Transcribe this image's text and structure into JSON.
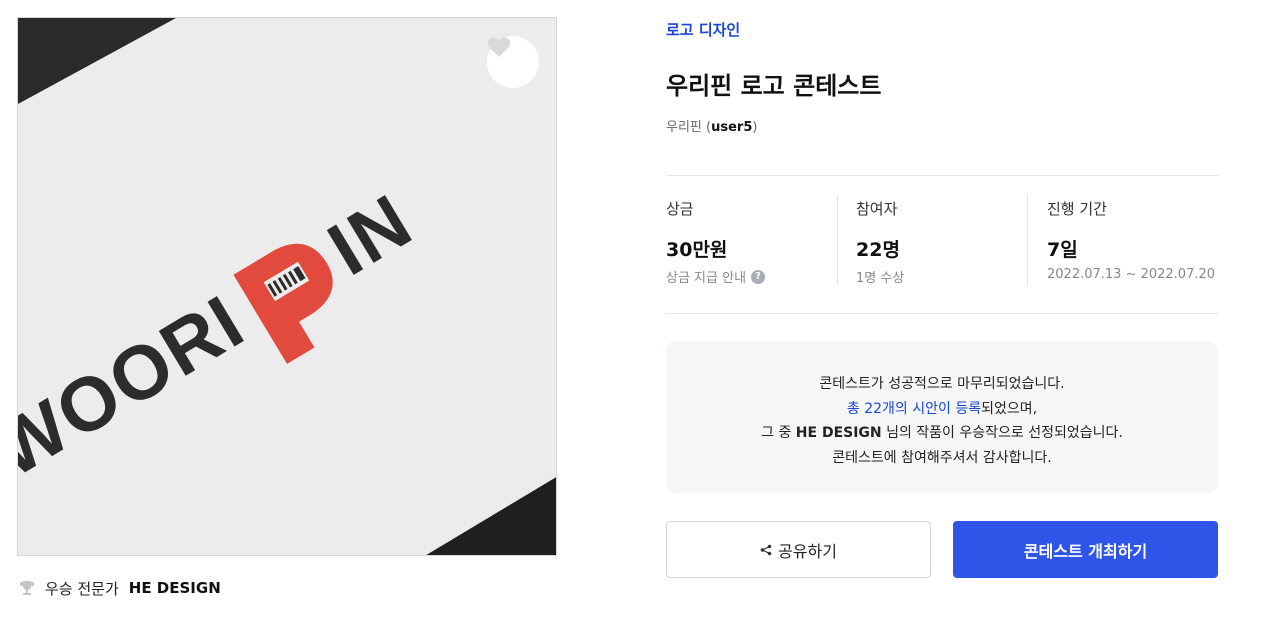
{
  "hero": {
    "logo_text_left": "WOORI",
    "logo_text_right": "IN",
    "like_icon": "heart-icon",
    "colors": {
      "logo_dark": "#2d2b2b",
      "logo_red": "#e14a3c",
      "paper": "#ececec",
      "corner": "#222222"
    }
  },
  "winner": {
    "icon": "trophy-icon",
    "prefix": "우승 전문가",
    "name": "HE DESIGN"
  },
  "category": "로고 디자인",
  "title": "우리핀 로고 콘테스트",
  "host": {
    "name": "우리핀",
    "open_paren": " (",
    "user": "user5",
    "close_paren": ")"
  },
  "stats": {
    "prize": {
      "label": "상금",
      "value": "30만원",
      "sub": "상금 지급 안내",
      "help_icon": "question-icon"
    },
    "participants": {
      "label": "참여자",
      "value": "22명",
      "sub": "1명 수상"
    },
    "period": {
      "label": "진행 기간",
      "value": "7일",
      "sub": "2022.07.13 ~ 2022.07.20"
    }
  },
  "notice": {
    "line1": "콘테스트가 성공적으로 마무리되었습니다.",
    "line2_link": "총 22개의 시안이 등록",
    "line2_rest": "되었으며,",
    "line3_pre": "그 중 ",
    "line3_bold": "HE DESIGN",
    "line3_post": " 님의 작품이 우승작으로 선정되었습니다.",
    "line4": "콘테스트에 참여해주셔서 감사합니다."
  },
  "buttons": {
    "share_icon": "share-icon",
    "share_label": "공유하기",
    "host_label": "콘테스트 개최하기"
  },
  "accent_color": "#2e55e8"
}
